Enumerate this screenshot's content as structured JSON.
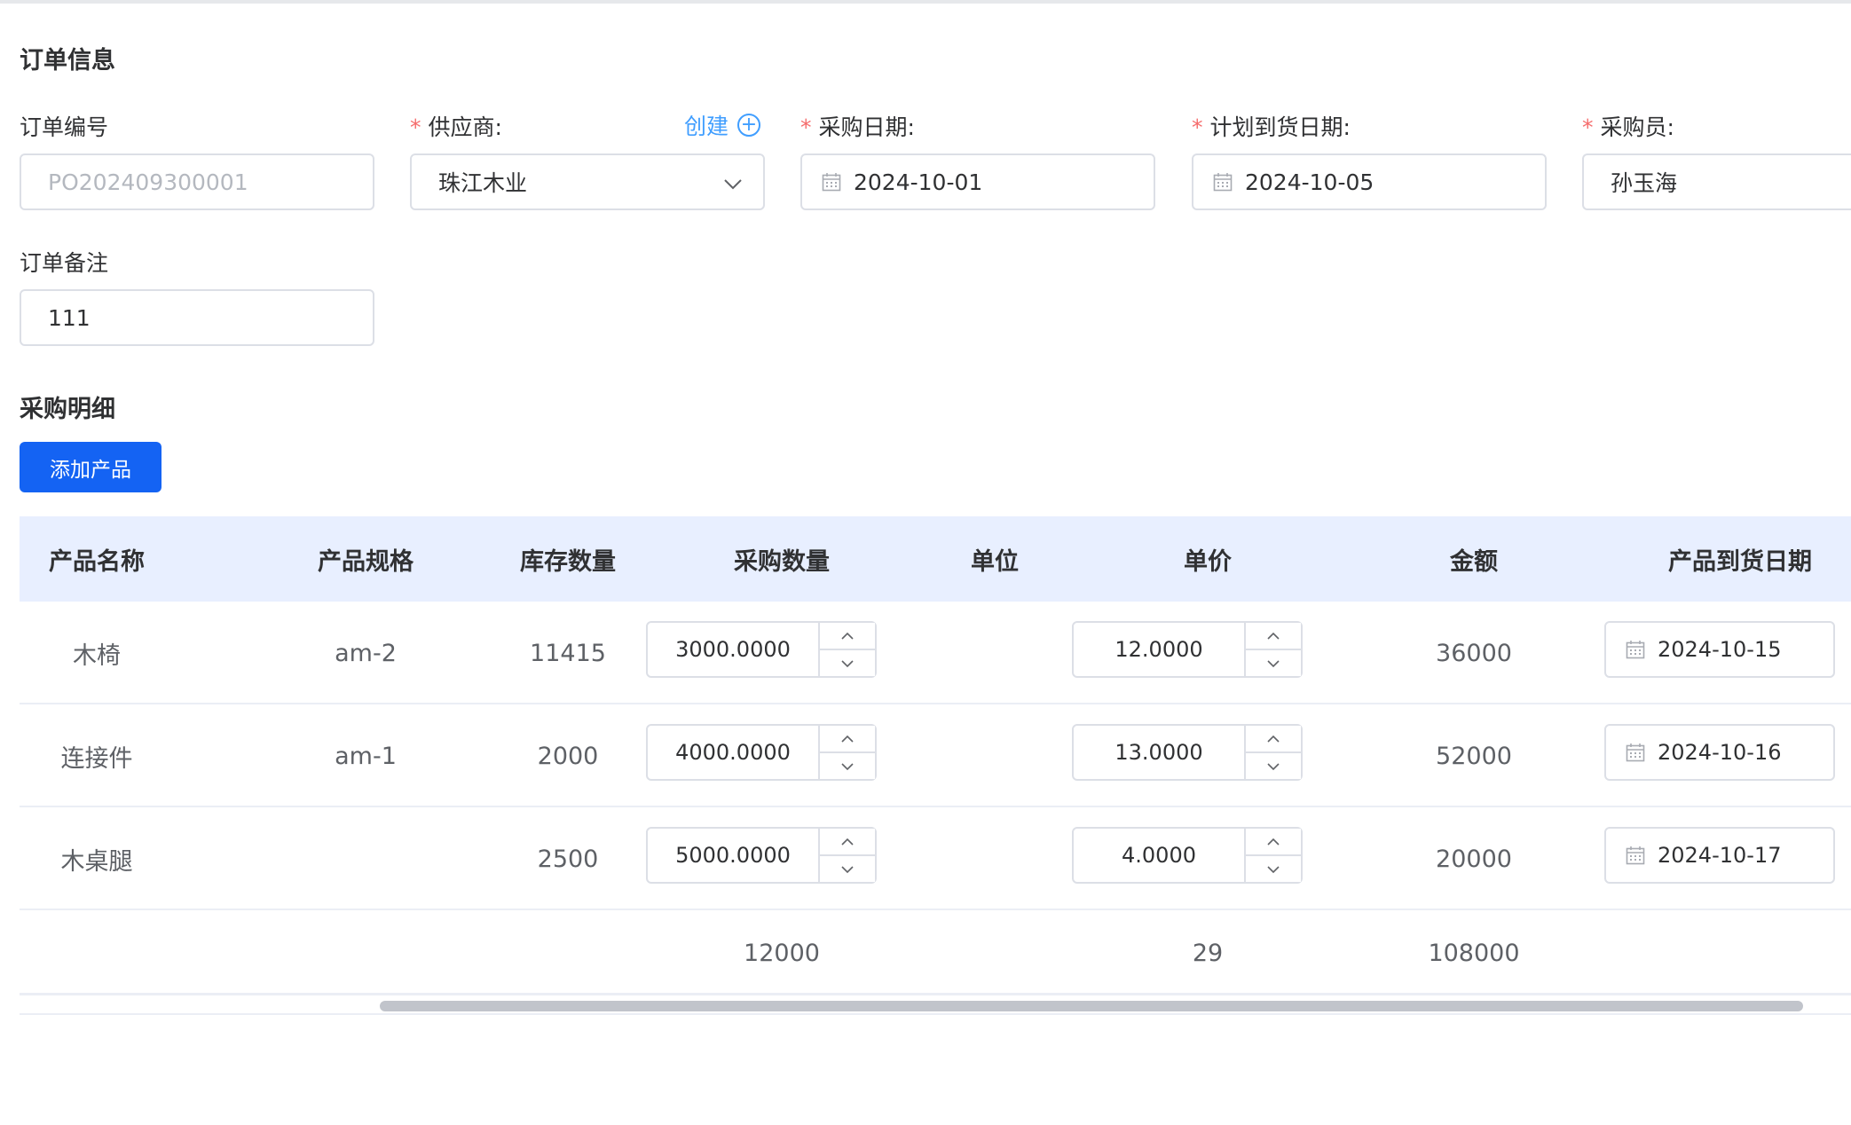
{
  "order_info": {
    "title": "订单信息",
    "order_no": {
      "label": "订单编号",
      "placeholder": "PO202409300001"
    },
    "supplier": {
      "label": "供应商:",
      "value": "珠江木业",
      "create_link": "创建"
    },
    "purchase_date": {
      "label": "采购日期:",
      "value": "2024-10-01"
    },
    "planned_arrival": {
      "label": "计划到货日期:",
      "value": "2024-10-05"
    },
    "buyer": {
      "label": "采购员:",
      "value": "孙玉海"
    },
    "remark": {
      "label": "订单备注",
      "value": "111"
    },
    "required_mark": "*"
  },
  "details": {
    "title": "采购明细",
    "add_button": "添加产品",
    "columns": [
      "产品名称",
      "产品规格",
      "库存数量",
      "采购数量",
      "单位",
      "单价",
      "金额",
      "产品到货日期"
    ],
    "rows": [
      {
        "name": "木椅",
        "spec": "am-2",
        "stock": "11415",
        "qty": "3000.0000",
        "unit": "",
        "price": "12.0000",
        "amount": "36000",
        "arrival": "2024-10-15"
      },
      {
        "name": "连接件",
        "spec": "am-1",
        "stock": "2000",
        "qty": "4000.0000",
        "unit": "",
        "price": "13.0000",
        "amount": "52000",
        "arrival": "2024-10-16"
      },
      {
        "name": "木桌腿",
        "spec": "",
        "stock": "2500",
        "qty": "5000.0000",
        "unit": "",
        "price": "4.0000",
        "amount": "20000",
        "arrival": "2024-10-17"
      }
    ],
    "summary": {
      "qty": "12000",
      "price": "29",
      "amount": "108000"
    }
  },
  "colors": {
    "accent": "#1463f3",
    "link": "#409eff",
    "required": "#f56c6c",
    "header_bg": "#e8efff"
  },
  "icons": [
    "calendar-icon",
    "chevron-down-icon",
    "plus-circle-icon",
    "arrow-up-icon",
    "arrow-down-icon"
  ]
}
